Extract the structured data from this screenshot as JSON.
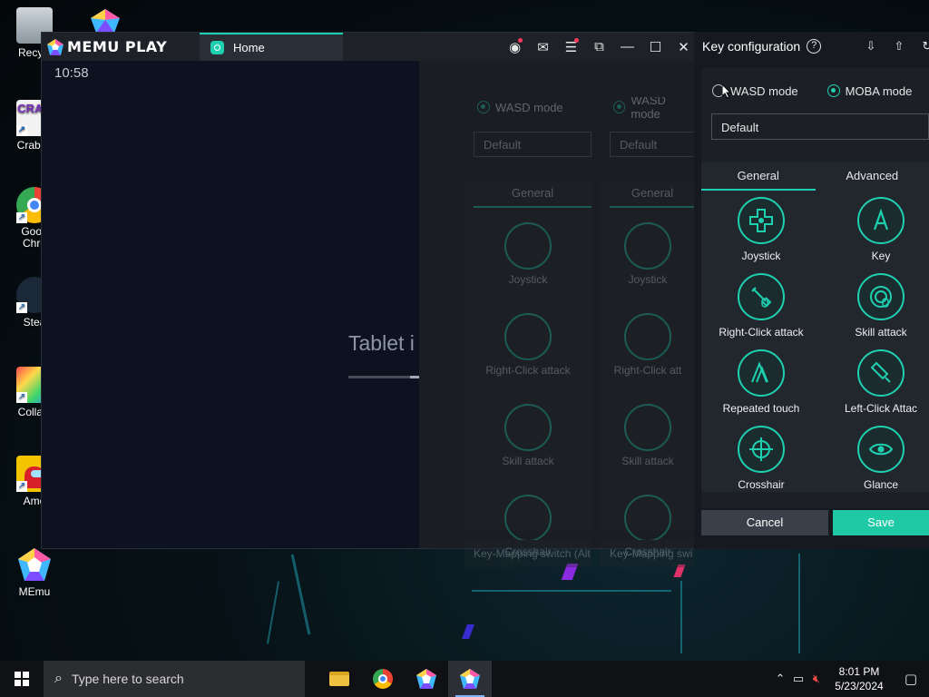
{
  "desktop": {
    "icons": [
      {
        "label": "Recycl",
        "name": "recycle-bin"
      },
      {
        "label": "Crab G",
        "name": "crab-game"
      },
      {
        "label": "Goog\nChro",
        "name": "google-chrome"
      },
      {
        "label": "Stea",
        "name": "steam"
      },
      {
        "label": "Collabl",
        "name": "collabl"
      },
      {
        "label": "Amo",
        "name": "among-us"
      },
      {
        "label": "MEmu",
        "name": "memu"
      }
    ]
  },
  "memu": {
    "logo_text": "MEMU PLAY",
    "tab_label": "Home",
    "clock": "10:58",
    "loading_text": "Tablet i",
    "loading_progress": 0.15
  },
  "ghost_panels": [
    {
      "mode_label": "WASD mode",
      "scheme": "Default",
      "tab": "General",
      "items": [
        "Joystick",
        "Right-Click attack",
        "Skill attack",
        "Crosshair"
      ],
      "key_mapping_switch": "Key-Mapping switch (Alt"
    },
    {
      "mode_label": "WASD mode",
      "scheme": "Default",
      "tab": "General",
      "items": [
        "Joystick",
        "Right-Click att",
        "Skill attack",
        "Crosshair"
      ],
      "key_mapping_switch": "Key-Mapping swi"
    }
  ],
  "key_config": {
    "title": "Key configuration",
    "help_symbol": "?",
    "modes": [
      {
        "label": "WASD mode",
        "checked": false
      },
      {
        "label": "MOBA mode",
        "checked": true
      }
    ],
    "scheme": "Default",
    "tabs": [
      {
        "label": "General",
        "active": true
      },
      {
        "label": "Advanced",
        "active": false
      }
    ],
    "items": [
      {
        "label": "Joystick",
        "icon": "joystick-icon"
      },
      {
        "label": "Key",
        "icon": "key-a-icon"
      },
      {
        "label": "Right-Click attack",
        "icon": "right-click-attack-icon"
      },
      {
        "label": "Skill attack",
        "icon": "skill-attack-icon"
      },
      {
        "label": "Repeated touch",
        "icon": "repeated-touch-icon"
      },
      {
        "label": "Left-Click Attac",
        "icon": "left-click-attack-icon"
      },
      {
        "label": "Crosshair",
        "icon": "crosshair-icon"
      },
      {
        "label": "Glance",
        "icon": "eye-icon"
      }
    ],
    "cancel_label": "Cancel",
    "save_label": "Save"
  },
  "taskbar": {
    "search_placeholder": "Type here to search",
    "time": "8:01 PM",
    "date": "5/23/2024"
  },
  "colors": {
    "accent": "#1fd0b0",
    "save_button": "#1fc9a6",
    "panel_bg": "#16191f"
  }
}
